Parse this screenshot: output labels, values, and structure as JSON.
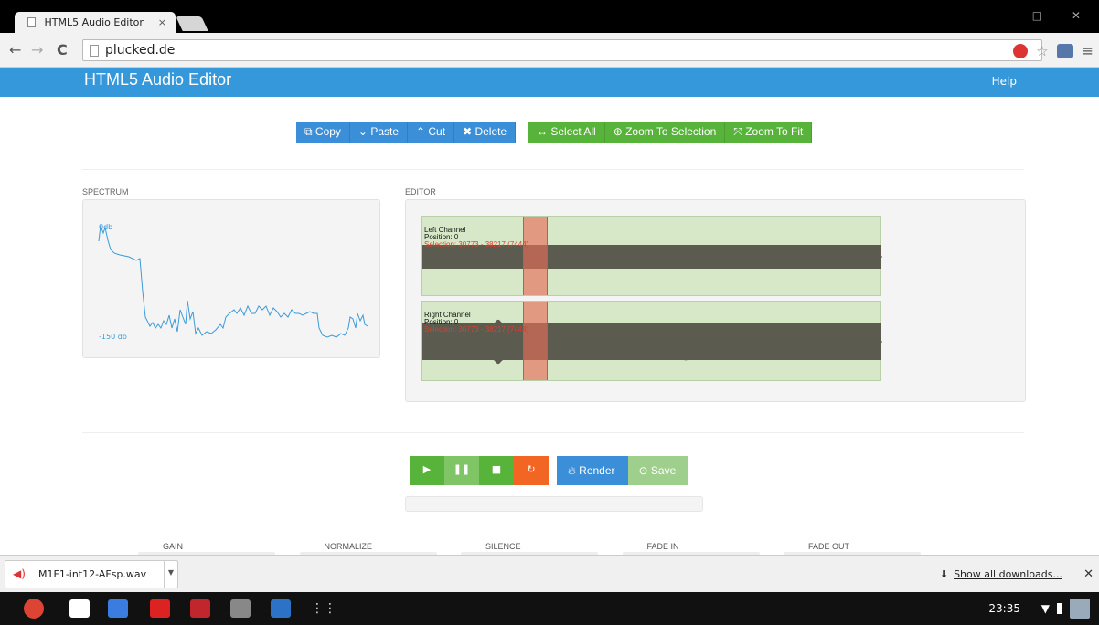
{
  "browser": {
    "tab_title": "HTML5 Audio Editor",
    "tab_close": "×",
    "url": "plucked.de",
    "window_buttons": "□ ✕"
  },
  "app": {
    "title": "HTML5 Audio Editor",
    "help": "Help"
  },
  "edit_toolbar": [
    {
      "icon": "copy-icon",
      "glyph": "⧉",
      "label": "Copy",
      "color": "#3a8fd8"
    },
    {
      "icon": "chevron-down-icon",
      "glyph": "⌄",
      "label": "Paste",
      "color": "#3a8fd8"
    },
    {
      "icon": "chevron-up-icon",
      "glyph": "⌃",
      "label": "Cut",
      "color": "#3a8fd8"
    },
    {
      "icon": "close-icon",
      "glyph": "✖",
      "label": "Delete",
      "color": "#3a8fd8"
    }
  ],
  "zoom_toolbar": [
    {
      "icon": "arrows-horizontal-icon",
      "glyph": "↔",
      "label": "Select All",
      "color": "#58b33b"
    },
    {
      "icon": "plus-circle-icon",
      "glyph": "⊕",
      "label": "Zoom To Selection",
      "color": "#58b33b"
    },
    {
      "icon": "fullscreen-icon",
      "glyph": "⤧",
      "label": "Zoom To Fit",
      "color": "#58b33b"
    }
  ],
  "spectrum": {
    "label": "SPECTRUM",
    "top_label": "0db",
    "bottom_label": "-150 db"
  },
  "editor": {
    "label": "EDITOR",
    "left": {
      "name": "Left Channel",
      "position": "Position: 0",
      "selection": "Selection: 30773 - 38217 (7444)"
    },
    "right": {
      "name": "Right Channel",
      "position": "Position: 0",
      "selection": "Selection: 30773 - 38217 (7444)"
    }
  },
  "transport": [
    {
      "name": "play-button",
      "icon": "play-icon",
      "glyph": "▶",
      "color": "#58b33b"
    },
    {
      "name": "pause-button",
      "icon": "pause-icon",
      "glyph": "❚❚",
      "color": "#7fc566"
    },
    {
      "name": "stop-button",
      "icon": "stop-icon",
      "glyph": "■",
      "color": "#58b33b"
    },
    {
      "name": "loop-button",
      "icon": "refresh-icon",
      "glyph": "↻",
      "color": "#f26522"
    }
  ],
  "render_label": "Render",
  "save_label": "Save",
  "effects": [
    "GAIN",
    "NORMALIZE",
    "SILENCE",
    "FADE IN",
    "FADE OUT"
  ],
  "download": {
    "file": "M1F1-int12-AFsp.wav",
    "show_all": "Show all downloads...",
    "close": "✕"
  },
  "shelf": {
    "clock": "23:35"
  }
}
